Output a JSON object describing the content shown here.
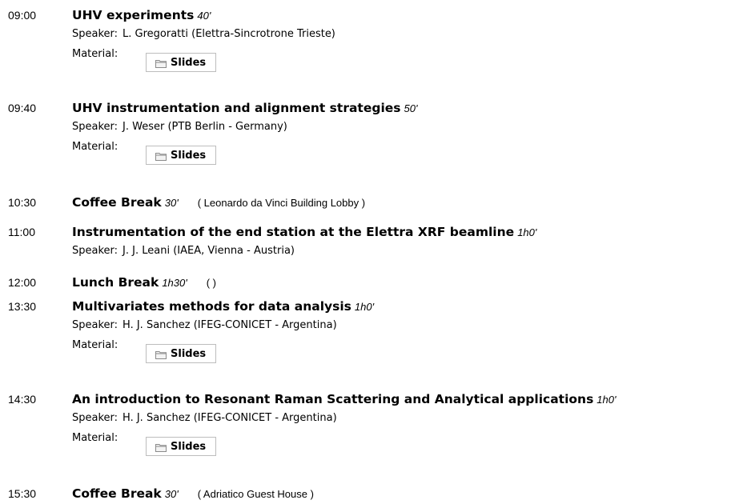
{
  "labels": {
    "speaker": "Speaker:",
    "material": "Material:"
  },
  "entries": [
    {
      "time": "09:00",
      "title": "UHV experiments",
      "duration": "40'",
      "speaker": "L. Gregoratti (Elettra-Sincrotrone Trieste)",
      "material_button": "Slides"
    },
    {
      "time": "09:40",
      "title": "UHV instrumentation and alignment strategies",
      "duration": "50'",
      "speaker": "J. Weser (PTB Berlin - Germany)",
      "material_button": "Slides"
    },
    {
      "time": "10:30",
      "title": "Coffee Break",
      "duration": "30'",
      "location": "( Leonardo da Vinci Building Lobby )"
    },
    {
      "time": "11:00",
      "title": "Instrumentation of the end station at the Elettra XRF beamline",
      "duration": "1h0'",
      "speaker": "J. J. Leani (IAEA, Vienna - Austria)"
    },
    {
      "time": "12:00",
      "title": "Lunch Break",
      "duration": "1h30'",
      "location": "( )"
    },
    {
      "time": "13:30",
      "title": "Multivariates methods for data analysis",
      "duration": "1h0'",
      "speaker": "H. J. Sanchez (IFEG-CONICET - Argentina)",
      "material_button": "Slides"
    },
    {
      "time": "14:30",
      "title": "An introduction to Resonant Raman Scattering and Analytical applications",
      "duration": "1h0'",
      "speaker": "H. J. Sanchez (IFEG-CONICET - Argentina)",
      "material_button": "Slides"
    },
    {
      "time": "15:30",
      "title": "Coffee Break",
      "duration": "30'",
      "location": "( Adriatico Guest House )"
    }
  ],
  "icons": {
    "folder": "folder-icon"
  },
  "colors": {
    "button_border": "#bdbdbd",
    "folder_fill": "#f3f3f3",
    "folder_stroke": "#8a8a8a"
  }
}
